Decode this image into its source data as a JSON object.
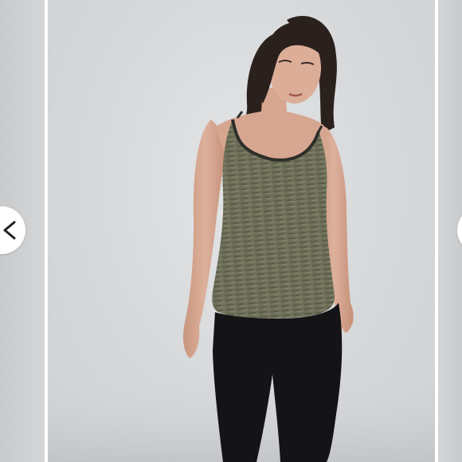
{
  "carousel": {
    "prev_icon": "chevron-left-icon",
    "next_icon": "chevron-right-icon",
    "background_color": "#d6d8da"
  },
  "product": {
    "top_color": "#6b6c55",
    "trim_color": "#2e2e2a",
    "leggings_color": "#141417",
    "hair_color": "#2b211c",
    "skin_color": "#d8a993"
  }
}
